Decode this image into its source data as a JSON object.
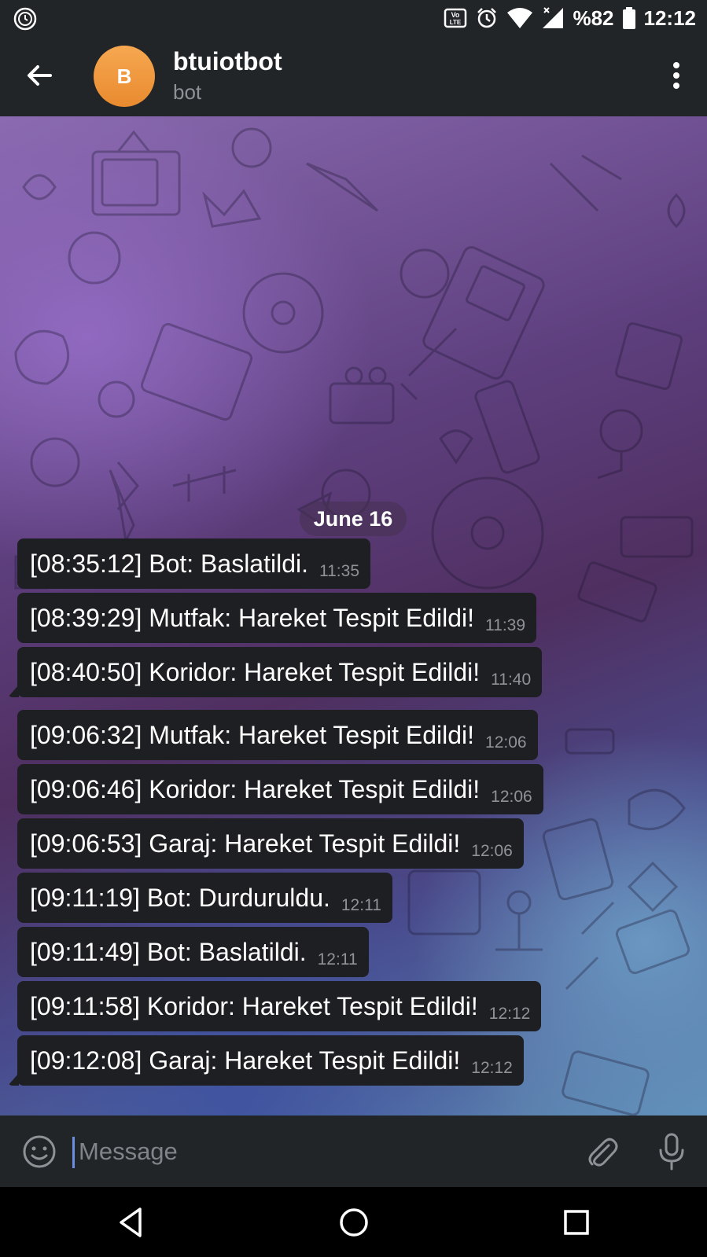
{
  "status_bar": {
    "left_icon": "clock-sync-icon",
    "volte_label": "Vo LTE",
    "battery": "%82",
    "time": "12:12"
  },
  "header": {
    "avatar_letter": "B",
    "title": "btuiotbot",
    "subtitle": "bot",
    "avatar_color": "#f0963f"
  },
  "chat": {
    "date_label": "June 16",
    "messages": [
      {
        "text": "[08:35:12] Bot: Baslatildi.",
        "time": "11:35"
      },
      {
        "text": "[08:39:29] Mutfak: Hareket Tespit Edildi!",
        "time": "11:39"
      },
      {
        "text": "[08:40:50] Koridor: Hareket Tespit Edildi!",
        "time": "11:40"
      },
      {
        "text": "[09:06:32] Mutfak: Hareket Tespit Edildi!",
        "time": "12:06"
      },
      {
        "text": "[09:06:46] Koridor: Hareket Tespit Edildi!",
        "time": "12:06"
      },
      {
        "text": "[09:06:53] Garaj: Hareket Tespit Edildi!",
        "time": "12:06"
      },
      {
        "text": "[09:11:19] Bot: Durduruldu.",
        "time": "12:11"
      },
      {
        "text": "[09:11:49] Bot: Baslatildi.",
        "time": "12:11"
      },
      {
        "text": "[09:11:58] Koridor: Hareket Tespit Edildi!",
        "time": "12:12"
      },
      {
        "text": "[09:12:08] Garaj: Hareket Tespit Edildi!",
        "time": "12:12"
      }
    ]
  },
  "composer": {
    "placeholder": "Message"
  },
  "colors": {
    "bar_bg": "#222527",
    "bubble_bg": "#1e1f22",
    "time_text": "#8f9398"
  }
}
